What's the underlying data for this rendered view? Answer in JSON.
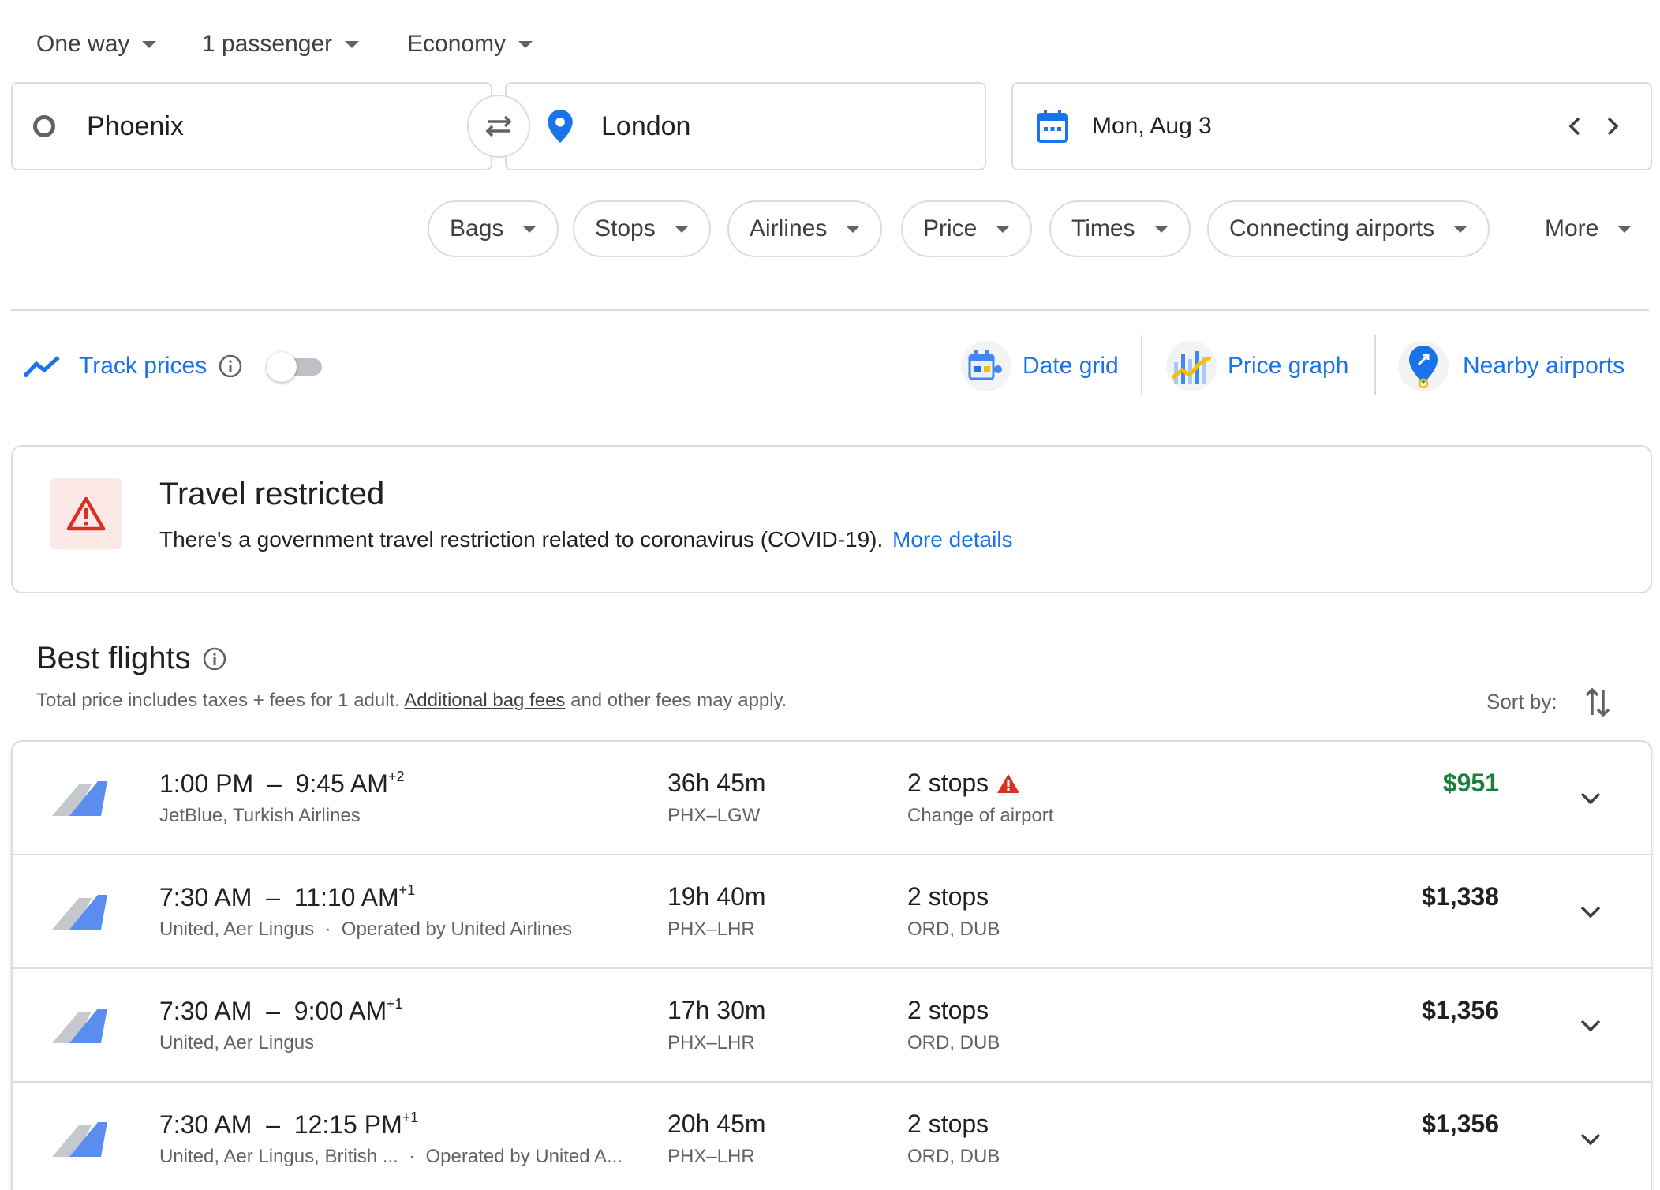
{
  "top_selectors": {
    "trip_type": "One way",
    "passengers": "1 passenger",
    "cabin": "Economy"
  },
  "search": {
    "origin": "Phoenix",
    "destination": "London",
    "date": "Mon, Aug 3"
  },
  "filters": {
    "bags": "Bags",
    "stops": "Stops",
    "airlines": "Airlines",
    "price": "Price",
    "times": "Times",
    "connecting": "Connecting airports",
    "more": "More"
  },
  "tools": {
    "track_prices": "Track prices",
    "track_prices_on": false,
    "date_grid": "Date grid",
    "price_graph": "Price graph",
    "nearby_airports": "Nearby airports"
  },
  "alert": {
    "title": "Travel restricted",
    "body": "There's a government travel restriction related to coronavirus (COVID-19).",
    "link": "More details"
  },
  "best_flights": {
    "title": "Best flights",
    "note_before": "Total price includes taxes + fees for 1 adult.",
    "note_link": "Additional bag fees",
    "note_after": "and other fees may apply.",
    "sort_label": "Sort by:"
  },
  "flights": [
    {
      "depart": "1:00 PM",
      "arrive": "9:45 AM",
      "day_offset": "+2",
      "airlines": "JetBlue, Turkish Airlines",
      "operated": "",
      "duration": "36h 45m",
      "route": "PHX–LGW",
      "stops": "2 stops",
      "stop_info": "Change of airport",
      "warning": true,
      "price": "$951",
      "price_green": true
    },
    {
      "depart": "7:30 AM",
      "arrive": "11:10 AM",
      "day_offset": "+1",
      "airlines": "United, Aer Lingus",
      "operated": "Operated by United Airlines",
      "duration": "19h 40m",
      "route": "PHX–LHR",
      "stops": "2 stops",
      "stop_info": "ORD, DUB",
      "warning": false,
      "price": "$1,338",
      "price_green": false
    },
    {
      "depart": "7:30 AM",
      "arrive": "9:00 AM",
      "day_offset": "+1",
      "airlines": "United, Aer Lingus",
      "operated": "",
      "duration": "17h 30m",
      "route": "PHX–LHR",
      "stops": "2 stops",
      "stop_info": "ORD, DUB",
      "warning": false,
      "price": "$1,356",
      "price_green": false
    },
    {
      "depart": "7:30 AM",
      "arrive": "12:15 PM",
      "day_offset": "+1",
      "airlines": "United, Aer Lingus, British ...",
      "operated": "Operated by United A...",
      "duration": "20h 45m",
      "route": "PHX–LHR",
      "stops": "2 stops",
      "stop_info": "ORD, DUB",
      "warning": false,
      "price": "$1,356",
      "price_green": false
    }
  ],
  "colors": {
    "accent": "#1a73e8",
    "price_green": "#188038",
    "alert_red": "#d93025",
    "border": "#dadce0"
  }
}
